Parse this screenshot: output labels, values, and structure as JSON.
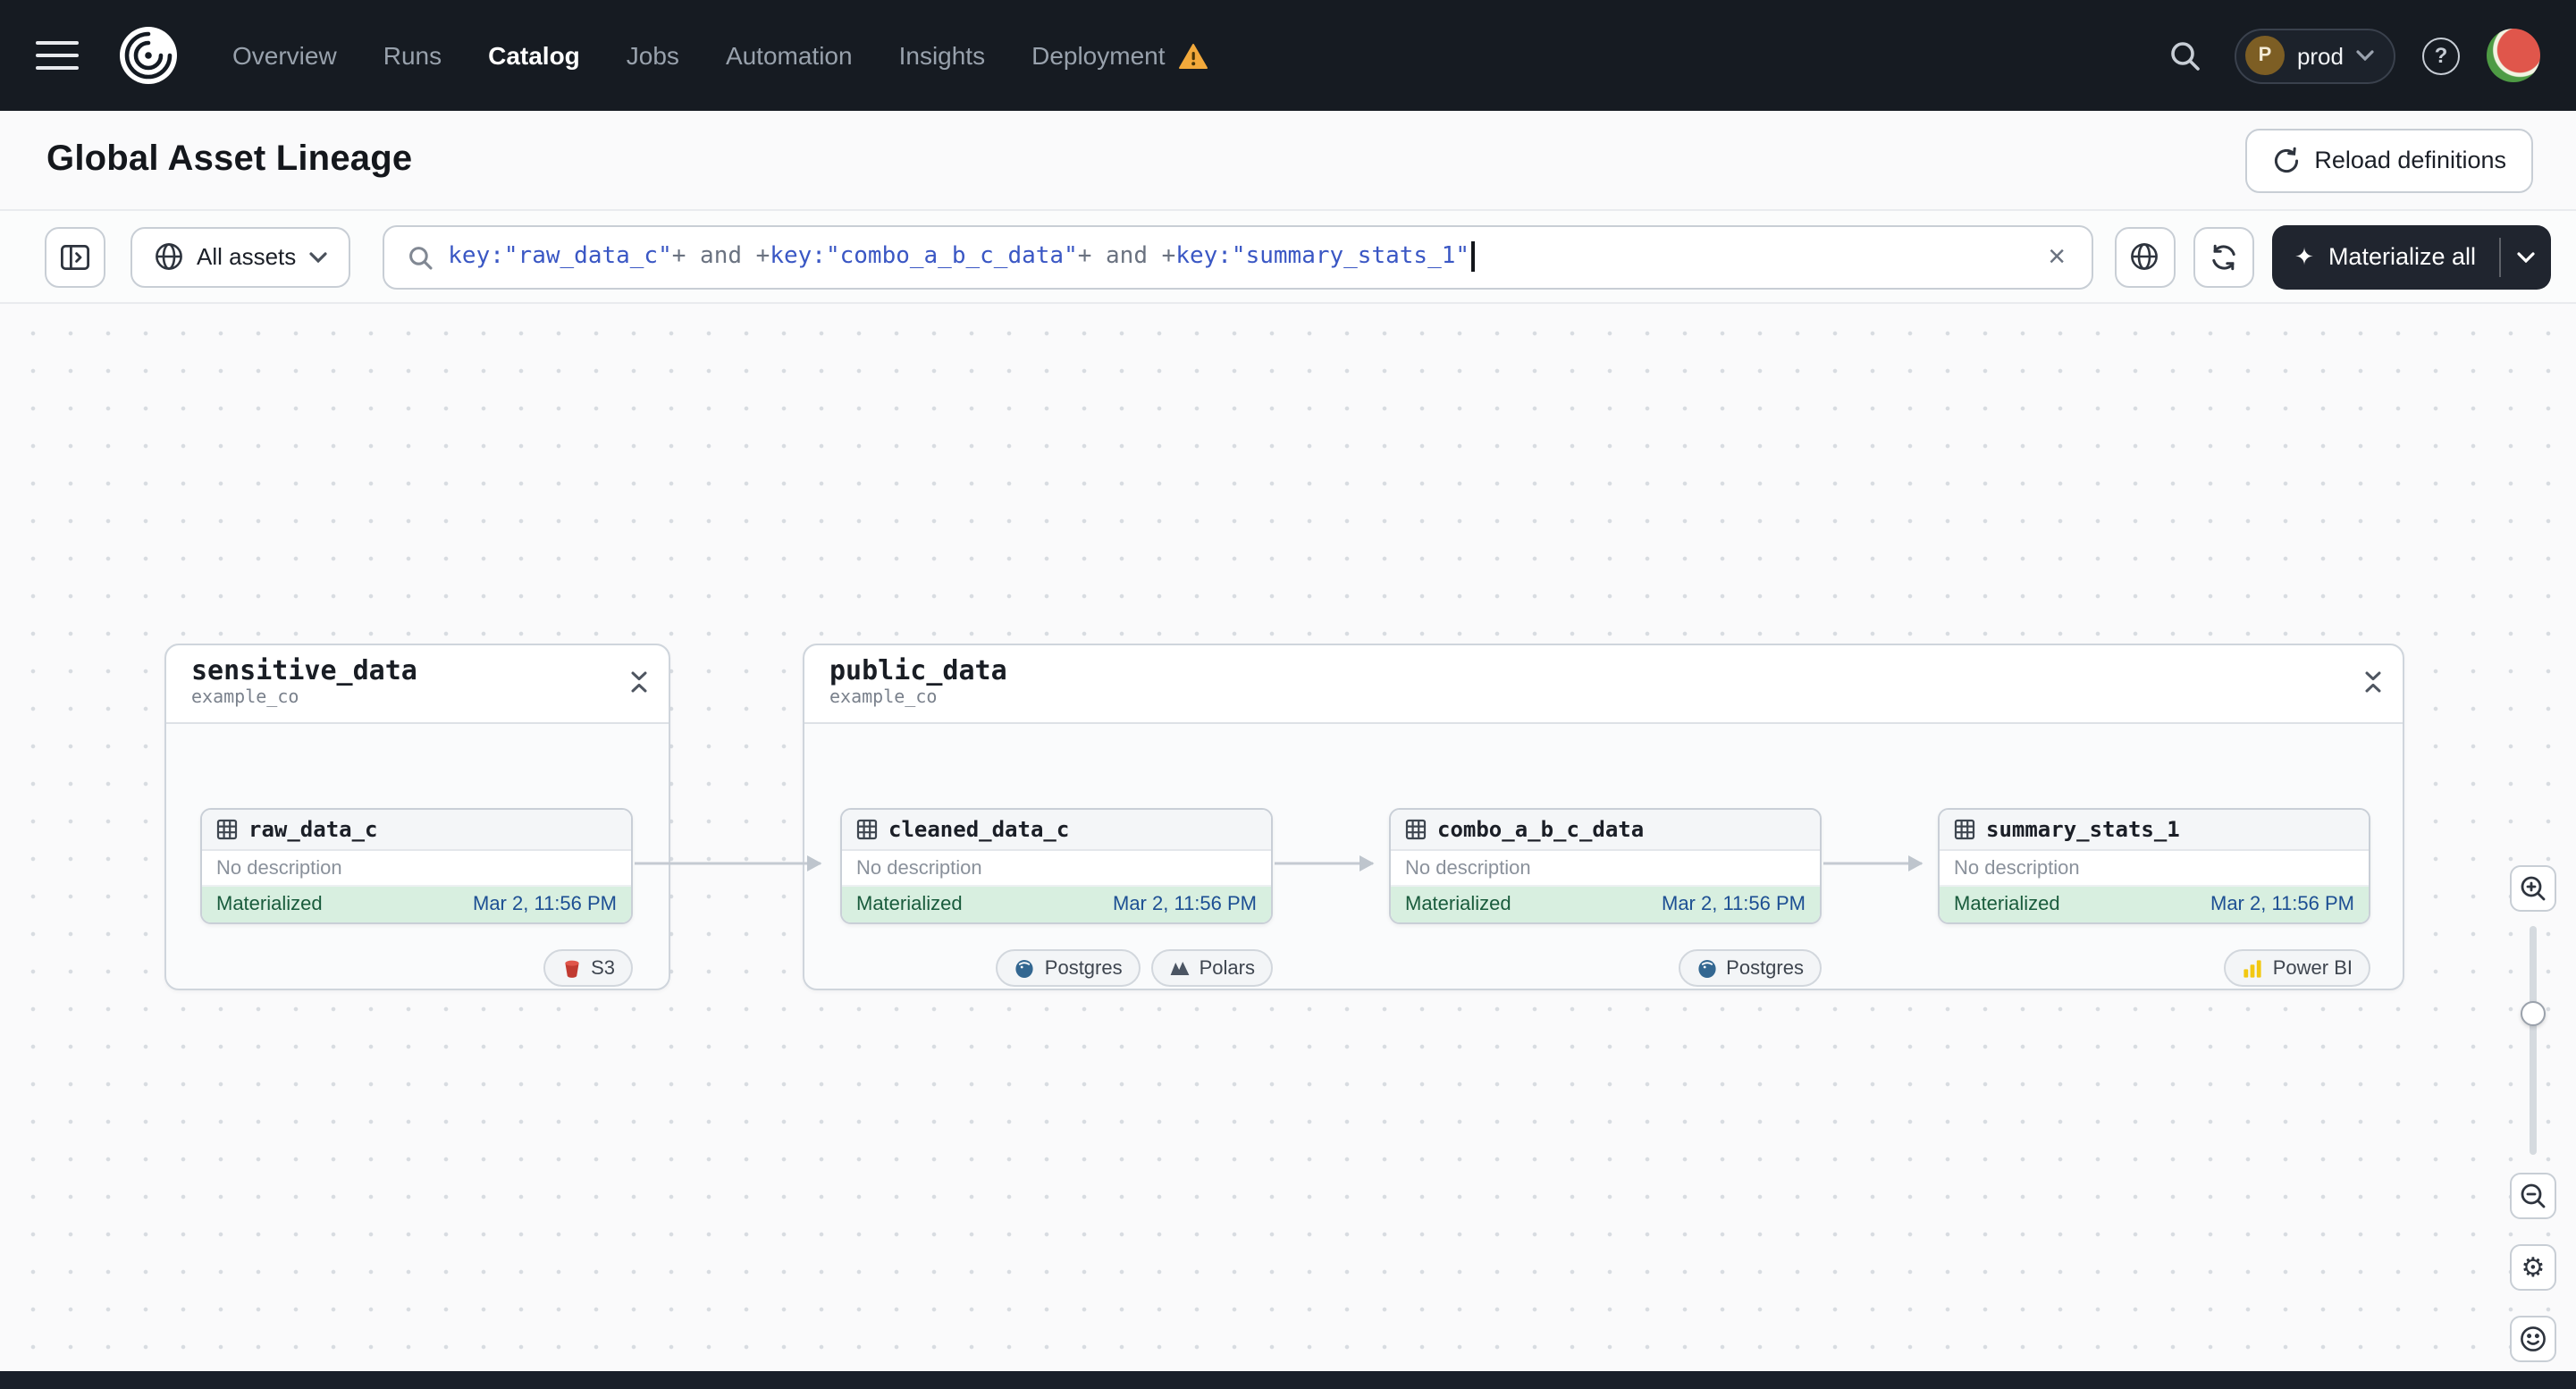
{
  "navbar": {
    "menu": [
      {
        "label": "Overview",
        "active": false
      },
      {
        "label": "Runs",
        "active": false
      },
      {
        "label": "Catalog",
        "active": true
      },
      {
        "label": "Jobs",
        "active": false
      },
      {
        "label": "Automation",
        "active": false
      },
      {
        "label": "Insights",
        "active": false
      },
      {
        "label": "Deployment",
        "active": false,
        "warning": true
      }
    ],
    "deployment": {
      "initial": "P",
      "name": "prod"
    }
  },
  "header": {
    "title": "Global Asset Lineage",
    "reload_label": "Reload definitions"
  },
  "toolbar": {
    "scope_label": "All assets",
    "query_tokens": [
      {
        "text": "key:\"raw_data_c\"",
        "type": "expr"
      },
      {
        "text": "+ and +",
        "type": "op"
      },
      {
        "text": "key:\"combo_a_b_c_data\"",
        "type": "expr"
      },
      {
        "text": "+ and +",
        "type": "op"
      },
      {
        "text": "key:\"summary_stats_1\"",
        "type": "expr"
      }
    ],
    "materialize_label": "Materialize all"
  },
  "graph": {
    "groups": [
      {
        "name": "sensitive_data",
        "org": "example_co"
      },
      {
        "name": "public_data",
        "org": "example_co"
      }
    ],
    "nodes": [
      {
        "name": "raw_data_c",
        "description": "No description",
        "status": "Materialized",
        "timestamp": "Mar 2, 11:56 PM",
        "tags": [
          {
            "label": "S3",
            "icon": "s3-icon"
          }
        ]
      },
      {
        "name": "cleaned_data_c",
        "description": "No description",
        "status": "Materialized",
        "timestamp": "Mar 2, 11:56 PM",
        "tags": [
          {
            "label": "Postgres",
            "icon": "postgres-icon"
          },
          {
            "label": "Polars",
            "icon": "polars-icon"
          }
        ]
      },
      {
        "name": "combo_a_b_c_data",
        "description": "No description",
        "status": "Materialized",
        "timestamp": "Mar 2, 11:56 PM",
        "tags": [
          {
            "label": "Postgres",
            "icon": "postgres-icon"
          }
        ]
      },
      {
        "name": "summary_stats_1",
        "description": "No description",
        "status": "Materialized",
        "timestamp": "Mar 2, 11:56 PM",
        "tags": [
          {
            "label": "Power BI",
            "icon": "powerbi-icon"
          }
        ]
      }
    ]
  },
  "icons": {
    "clear": "×",
    "sparkle": "✦",
    "gear": "⚙",
    "question": "?"
  },
  "colors": {
    "navbar_bg": "#161B22",
    "dark_button_bg": "#20252F",
    "materialized_bg": "#D8EFE0",
    "materialized_text": "#195B3C",
    "timestamp_link": "#1D4F93",
    "warning": "#F2A93B",
    "query_expr": "#3A57C4",
    "query_op": "#6A7280"
  }
}
